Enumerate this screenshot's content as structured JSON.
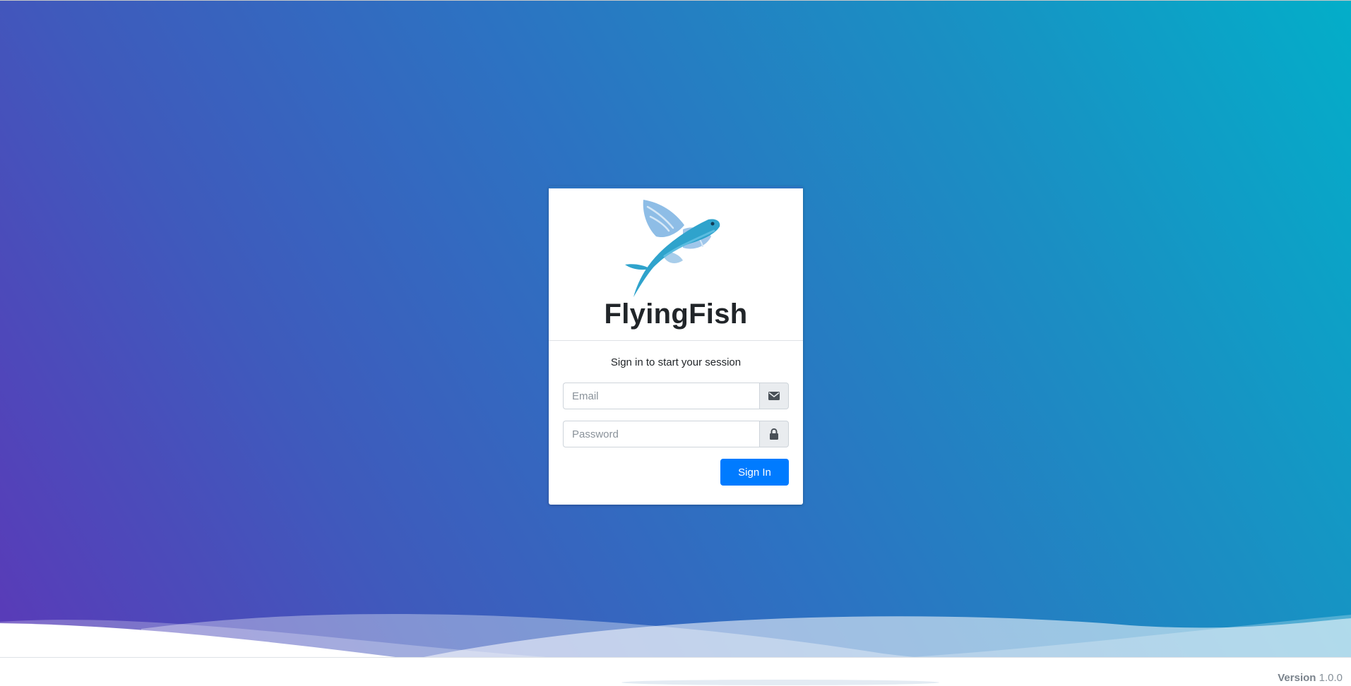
{
  "brand": {
    "name": "FlyingFish",
    "logo_icon": "flying-fish-logo"
  },
  "login": {
    "message": "Sign in to start your session",
    "email": {
      "placeholder": "Email",
      "value": "",
      "icon": "envelope-icon"
    },
    "password": {
      "placeholder": "Password",
      "value": "",
      "icon": "lock-icon"
    },
    "submit_label": "Sign In"
  },
  "footer": {
    "version_label": "Version",
    "version_number": "1.0.0"
  },
  "colors": {
    "gradient_start": "#5a3ab8",
    "gradient_end": "#03aec9",
    "primary_button": "#007bff",
    "fish_body": "#2fa3cc",
    "fish_fin": "#8ebde6"
  }
}
